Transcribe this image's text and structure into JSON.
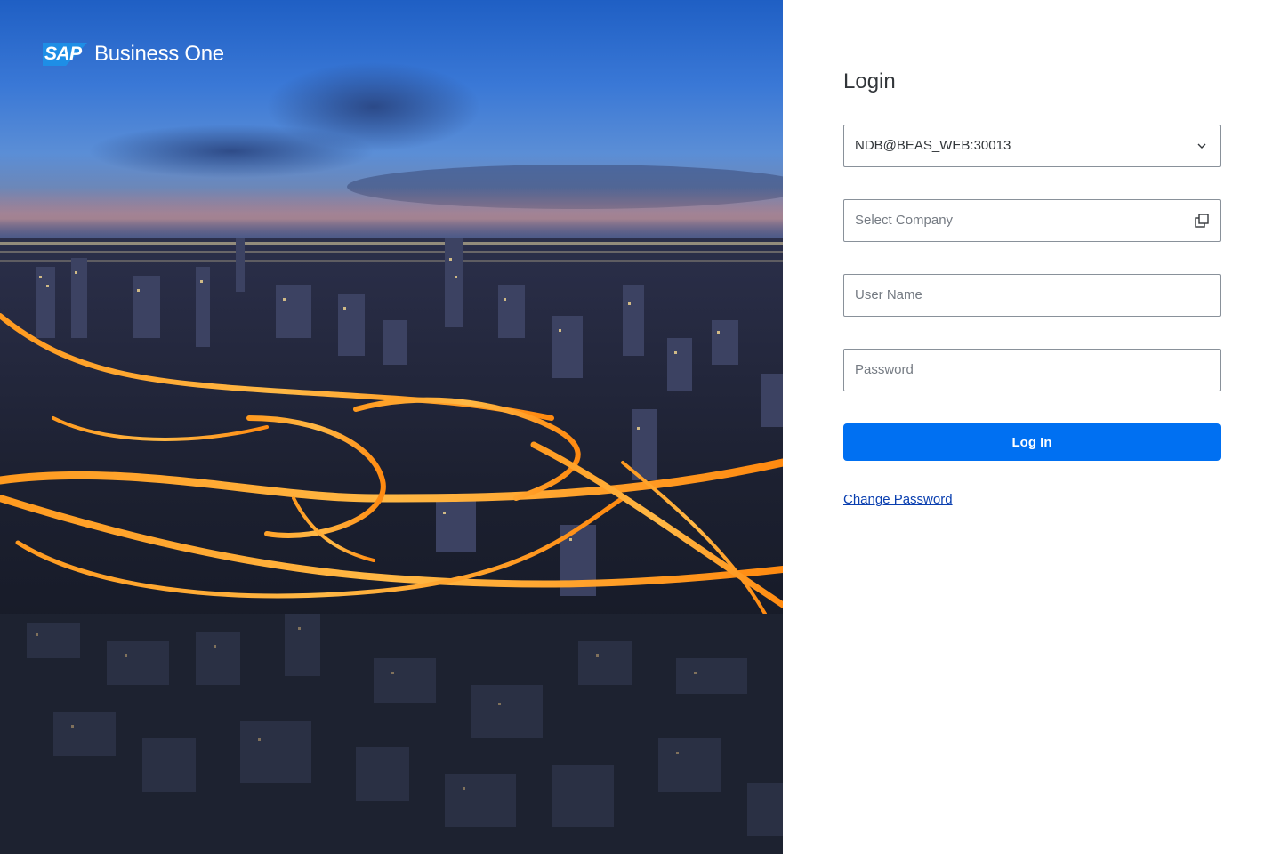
{
  "brand": {
    "badge": "SAP",
    "product": "Business One"
  },
  "login": {
    "title": "Login",
    "server_value": "NDB@BEAS_WEB:30013",
    "company_placeholder": "Select Company",
    "username_placeholder": "User Name",
    "password_placeholder": "Password",
    "login_button": "Log In",
    "change_password_link": "Change Password"
  },
  "icons": {
    "server_dropdown": "chevron-down-icon",
    "company_picker": "value-help-icon"
  },
  "colors": {
    "primary_button": "#0070f2",
    "link": "#0a3fb0",
    "field_border": "#89919a",
    "brand_badge": "#1e8ee6"
  }
}
